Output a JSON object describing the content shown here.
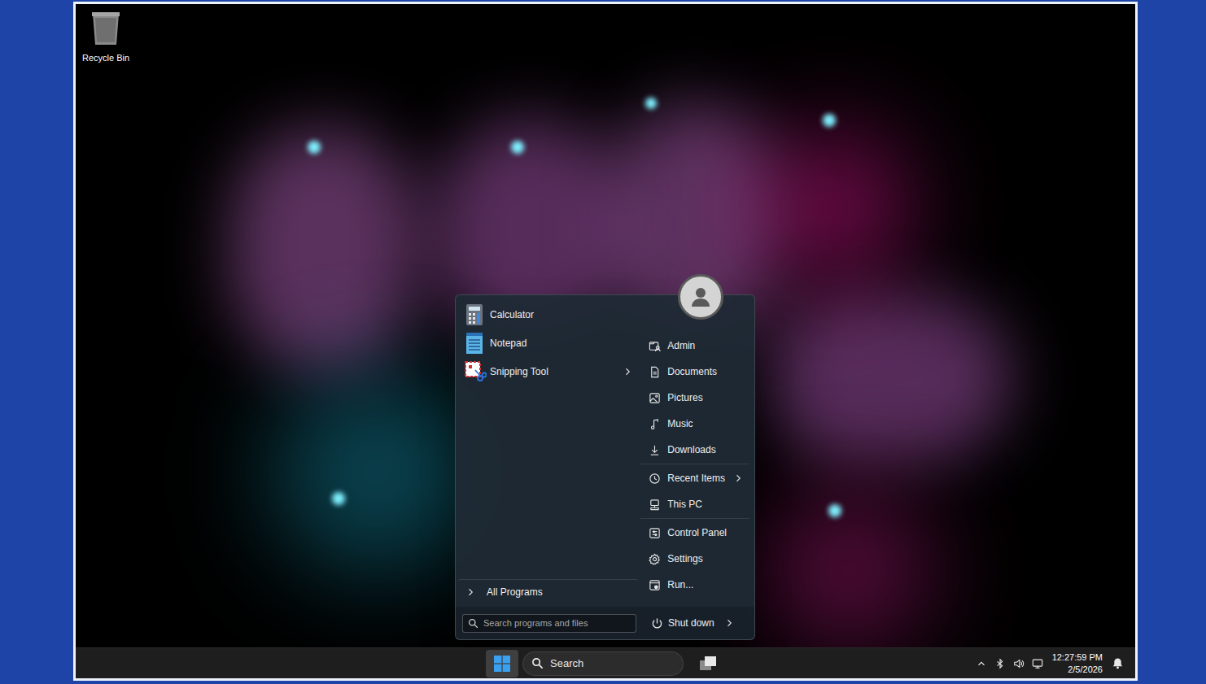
{
  "desktop": {
    "icons": [
      {
        "label": "Recycle Bin",
        "selected": false
      }
    ]
  },
  "start_menu": {
    "pinned": [
      {
        "label": "Calculator",
        "has_submenu": false
      },
      {
        "label": "Notepad",
        "has_submenu": false
      },
      {
        "label": "Snipping Tool",
        "has_submenu": true
      }
    ],
    "all_programs": {
      "label": "All Programs"
    },
    "search": {
      "placeholder": "Search programs and files"
    },
    "place_groups": [
      [
        {
          "label": "Admin",
          "has_submenu": false
        },
        {
          "label": "Documents",
          "has_submenu": false
        },
        {
          "label": "Pictures",
          "has_submenu": false
        },
        {
          "label": "Music",
          "has_submenu": false
        },
        {
          "label": "Downloads",
          "has_submenu": false
        }
      ],
      [
        {
          "label": "Recent Items",
          "has_submenu": true
        },
        {
          "label": "This PC",
          "has_submenu": false
        }
      ],
      [
        {
          "label": "Control Panel",
          "has_submenu": false
        },
        {
          "label": "Settings",
          "has_submenu": false
        },
        {
          "label": "Run...",
          "has_submenu": false
        }
      ]
    ],
    "shutdown": {
      "label": "Shut down",
      "has_submenu": true
    }
  },
  "taskbar": {
    "start_button": {
      "selected": true
    },
    "search": {
      "label": "Search"
    },
    "clock": {
      "time": "12:27:59 PM",
      "date": "2/5/2026"
    }
  }
}
